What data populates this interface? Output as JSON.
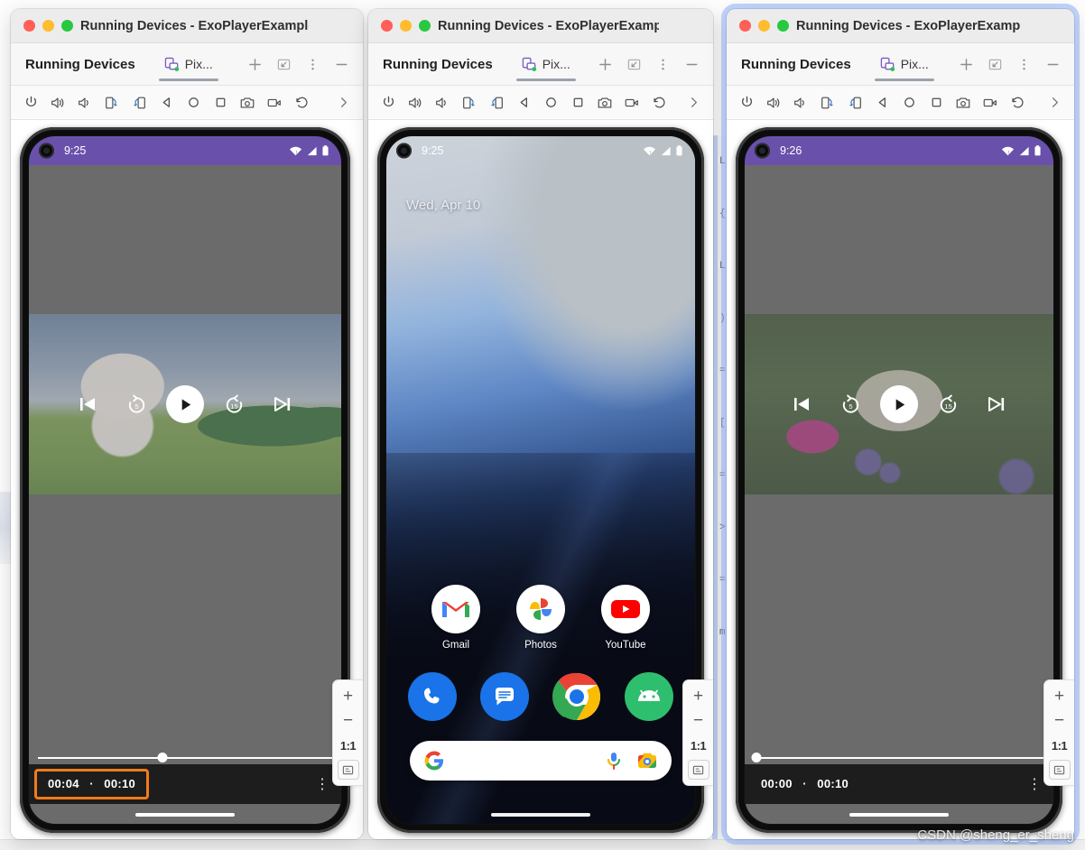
{
  "background": {
    "code_fragments": [
      "L",
      "{",
      "L",
      ")",
      "=",
      "[",
      "=",
      ">",
      "=",
      "m"
    ]
  },
  "watermark": "CSDN @sheng_er_sheng",
  "windows": [
    {
      "id": "window-left",
      "title": "Running Devices - ExoPlayerExampleA...",
      "tool_label": "Running Devices",
      "tab_label": "Pix...",
      "toolbar_icons": [
        "power-icon",
        "volume-up-icon",
        "volume-down-icon",
        "rotate-left-icon",
        "rotate-right-icon",
        "back-icon",
        "home-icon",
        "recents-icon",
        "screenshot-icon",
        "record-icon",
        "history-icon",
        "chevron-right-icon"
      ],
      "tabbar_actions": [
        "add-tab-icon",
        "minimize-panel-icon",
        "more-options-icon",
        "hide-panel-icon"
      ],
      "focused": false,
      "device": {
        "status_time": "9:25",
        "screen_mode": "video-player",
        "status_bar_color": "#6951ab",
        "video": "big-buck-bunny-field",
        "position": "00:04",
        "duration": "00:10",
        "separator": "·",
        "seek_percent": 40,
        "time_highlighted": true,
        "highlight_color": "#f07c1a"
      },
      "zoom_rail": {
        "zoom_in": "+",
        "zoom_out": "−",
        "actual_size": "1:1",
        "fit": "fit-icon"
      }
    },
    {
      "id": "window-middle",
      "title": "Running Devices - ExoPlayerExampleA...",
      "tool_label": "Running Devices",
      "tab_label": "Pix...",
      "toolbar_icons": [
        "power-icon",
        "volume-up-icon",
        "volume-down-icon",
        "rotate-left-icon",
        "rotate-right-icon",
        "back-icon",
        "home-icon",
        "recents-icon",
        "screenshot-icon",
        "record-icon",
        "history-icon",
        "chevron-right-icon"
      ],
      "tabbar_actions": [
        "add-tab-icon",
        "minimize-panel-icon",
        "more-options-icon",
        "hide-panel-icon"
      ],
      "focused": false,
      "device": {
        "status_time": "9:25",
        "screen_mode": "home-screen",
        "date_widget": "Wed, Apr 10",
        "apps": [
          {
            "name": "Gmail",
            "icon": "gmail-icon"
          },
          {
            "name": "Photos",
            "icon": "google-photos-icon"
          },
          {
            "name": "YouTube",
            "icon": "youtube-icon"
          }
        ],
        "dock": [
          {
            "name": "Phone",
            "icon": "phone-icon"
          },
          {
            "name": "Messages",
            "icon": "messages-icon"
          },
          {
            "name": "Chrome",
            "icon": "chrome-icon"
          },
          {
            "name": "ExoPlayer",
            "icon": "android-icon"
          }
        ],
        "search": {
          "logo": "google-g-icon",
          "mic": "microphone-icon",
          "lens": "google-lens-icon"
        }
      },
      "zoom_rail": {
        "zoom_in": "+",
        "zoom_out": "−",
        "actual_size": "1:1",
        "fit": "fit-icon"
      }
    },
    {
      "id": "window-right",
      "title": "Running Devices - ExoPlayerExampleA...",
      "tool_label": "Running Devices",
      "tab_label": "Pix...",
      "toolbar_icons": [
        "power-icon",
        "volume-up-icon",
        "volume-down-icon",
        "rotate-left-icon",
        "rotate-right-icon",
        "back-icon",
        "home-icon",
        "recents-icon",
        "screenshot-icon",
        "record-icon",
        "history-icon",
        "chevron-right-icon"
      ],
      "tabbar_actions": [
        "add-tab-icon",
        "minimize-panel-icon",
        "more-options-icon",
        "hide-panel-icon"
      ],
      "focused": true,
      "device": {
        "status_time": "9:26",
        "screen_mode": "video-player",
        "status_bar_color": "#6951ab",
        "video": "bunny-on-grass",
        "position": "00:00",
        "duration": "00:10",
        "separator": "·",
        "seek_percent": 1,
        "time_highlighted": false
      },
      "zoom_rail": {
        "zoom_in": "+",
        "zoom_out": "−",
        "actual_size": "1:1",
        "fit": "fit-icon"
      }
    }
  ]
}
